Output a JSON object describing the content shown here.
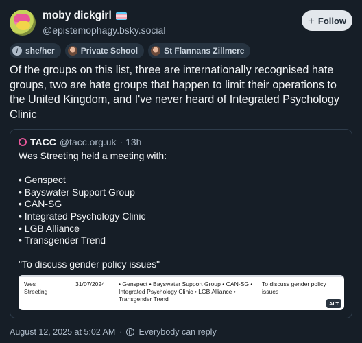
{
  "author": {
    "display_name": "moby dickgirl",
    "handle": "@epistemophagy.bsky.social",
    "follow_label": "Follow"
  },
  "badges": [
    {
      "label": "she/her",
      "icon": "slash-icon"
    },
    {
      "label": "Private School",
      "icon": "avatar-icon"
    },
    {
      "label": "St Flannans Zillmere",
      "icon": "avatar-icon"
    }
  ],
  "post_text": "Of the groups on this list, three are internationally recognised hate groups, two are hate groups that happen to limit their operations to the United Kingdom, and I've never heard of Integrated Psychology Clinic",
  "quote": {
    "name": "TACC",
    "handle": "@tacc.org.uk",
    "time": "· 13h",
    "intro": "Wes Streeting held a meeting with:",
    "items": [
      "• Genspect",
      "• Bayswater Support Group",
      "• CAN-SG",
      "• Integrated Psychology Clinic",
      "• LGB Alliance",
      "• Transgender Trend"
    ],
    "closing": "\"To discuss gender policy issues\"",
    "embed": {
      "who": "Wes Streeting",
      "date": "31/07/2024",
      "groups": "• Genspect • Bayswater Support Group • CAN-SG • Integrated Psychology Clinic • LGB Alliance • Transgender Trend",
      "purpose": "To discuss gender policy issues",
      "alt_label": "ALT"
    }
  },
  "meta": {
    "timestamp": "August 12, 2025 at 5:02 AM",
    "reply_setting": "Everybody can reply"
  },
  "colors": {
    "background": "#161e27",
    "accent_pink": "#e8579a"
  }
}
